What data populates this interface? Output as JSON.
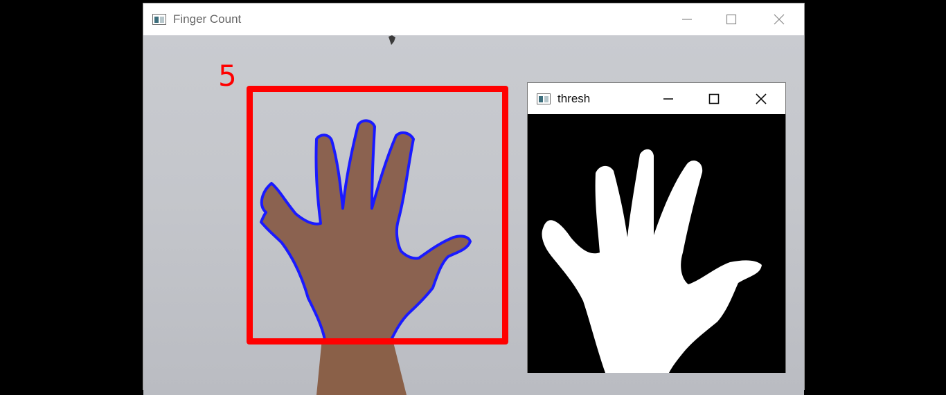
{
  "main_window": {
    "title": "Finger Count",
    "finger_count": "5",
    "colors": {
      "count_text": "#ff0000",
      "bounding_box": "#ff0000",
      "contour": "#1a1aff"
    }
  },
  "thresh_window": {
    "title": "thresh",
    "colors": {
      "background": "#000000",
      "mask": "#ffffff"
    }
  },
  "icons": {
    "app": "opencv-window-icon",
    "minimize": "minimize-icon",
    "maximize": "maximize-icon",
    "close": "close-icon"
  }
}
